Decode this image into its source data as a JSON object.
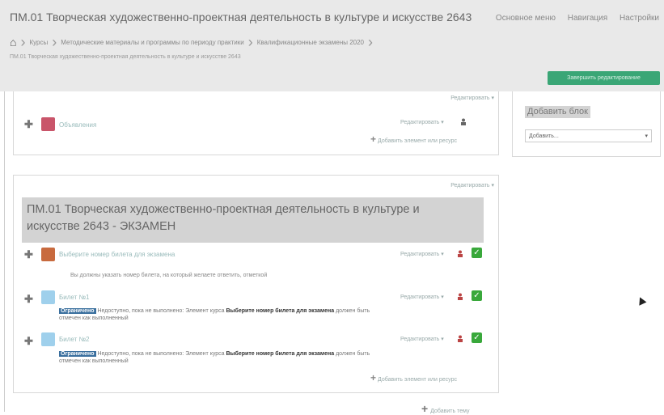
{
  "header": {
    "title": "ПМ.01 Творческая художественно-проектная деятельность в культуре и искусстве 2643",
    "menu": [
      "Основное меню",
      "Навигация",
      "Настройки"
    ],
    "breadcrumb": [
      "Курсы",
      "Методические материалы и программы по периоду практики",
      "Квалификационные экзамены 2020"
    ],
    "breadcrumb_sub": "ПМ.01 Творческая художественно-проектная деятельность в культуре и искусстве 2643",
    "edit_button": "Завершить редактирование"
  },
  "section1": {
    "edit": "Редактировать ▾",
    "activity": {
      "name": "Объявления",
      "edit": "Редактировать ▾"
    },
    "add": "Добавить элемент или ресурс"
  },
  "section2": {
    "edit": "Редактировать ▾",
    "title_line1": "ПМ.01 Творческая художественно-проектная деятельность в культуре и",
    "title_line2": "искусстве 2643 - ЭКЗАМЕН",
    "activities": [
      {
        "name": "Выберите номер билета для экзамена",
        "edit": "Редактировать ▾",
        "note": "Вы должны указать номер билета, на который желаете ответить, отметкой"
      },
      {
        "name": "Билет №1",
        "edit": "Редактировать ▾",
        "badge": "Ограничено",
        "r1": "Недоступно, пока не выполнено: Элемент курса",
        "r_bold": "Выберите номер билета для экзамена",
        "r2": "должен быть",
        "r3": "отмечен как выполненный"
      },
      {
        "name": "Билет №2",
        "edit": "Редактировать ▾",
        "badge": "Ограничено",
        "r1": "Недоступно, пока не выполнено: Элемент курса",
        "r_bold": "Выберите номер билета для экзамена",
        "r2": "должен быть",
        "r3": "отмечен как выполненный"
      }
    ],
    "add": "Добавить элемент или ресурс"
  },
  "block": {
    "title": "Добавить блок",
    "select": "Добавить..."
  },
  "add_topic": "Добавить тему",
  "colors": {
    "accent": "#3aa676",
    "badge": "#3a6f9e",
    "check": "#39a83b"
  }
}
